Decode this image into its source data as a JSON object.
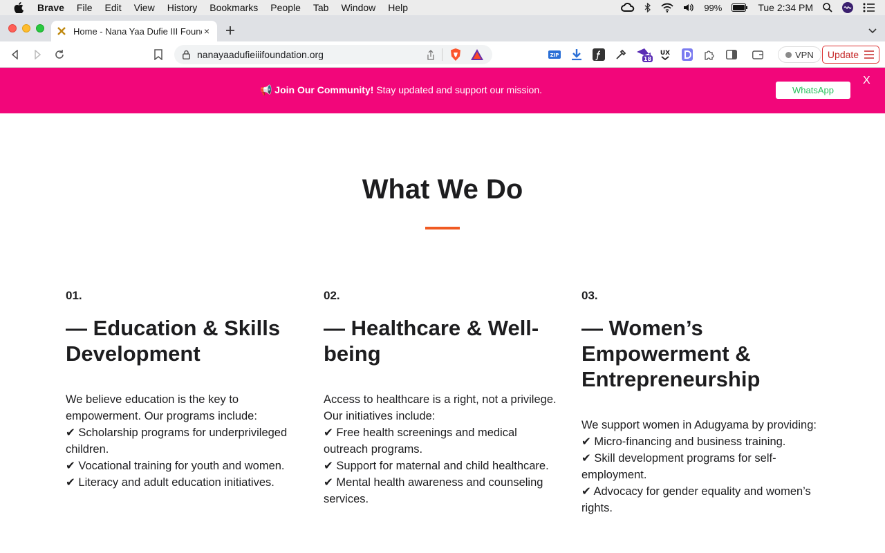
{
  "menubar": {
    "app": "Brave",
    "items": [
      "File",
      "Edit",
      "View",
      "History",
      "Bookmarks",
      "People",
      "Tab",
      "Window",
      "Help"
    ],
    "battery": "99%",
    "clock": "Tue 2:34 PM"
  },
  "tab": {
    "title": "Home - Nana Yaa Dufie III Foundation",
    "close": "×"
  },
  "toolbar": {
    "url": "nanayaadufieiiifoundation.org",
    "vpn_label": "VPN",
    "update_label": "Update",
    "ext_badge": "18",
    "zip_label": "ZIP",
    "ux_label": "UX"
  },
  "banner": {
    "emoji": "📢",
    "strong": "Join Our Community!",
    "text": "Stay updated and support our mission.",
    "button": "WhatsApp",
    "close": "X"
  },
  "section": {
    "title": "What We Do",
    "accent": "#f05a22",
    "columns": [
      {
        "number": "01.",
        "heading": "— Education & Skills Development",
        "intro": "We believe education is the key to empowerment. Our programs include:",
        "items": [
          "✔ Scholarship programs for underprivileged children.",
          "✔ Vocational training for youth and women.",
          "✔ Literacy and adult education initiatives."
        ]
      },
      {
        "number": "02.",
        "heading": "— Healthcare & Well-being",
        "intro": "Access to healthcare is a right, not a privilege. Our initiatives include:",
        "items": [
          "✔ Free health screenings and medical outreach programs.",
          "✔ Support for maternal and child healthcare.",
          "✔ Mental health awareness and counseling services."
        ]
      },
      {
        "number": "03.",
        "heading": "— Women’s Empowerment & Entrepreneurship",
        "intro": "We support women in Adugyama by providing:",
        "items": [
          "✔ Micro-financing and business training.",
          "✔ Skill development programs for self-employment.",
          "✔ Advocacy for gender equality and women’s rights."
        ]
      }
    ]
  },
  "colors": {
    "banner": "#f2067a",
    "whatsapp": "#25c15a",
    "update": "#c62828"
  }
}
